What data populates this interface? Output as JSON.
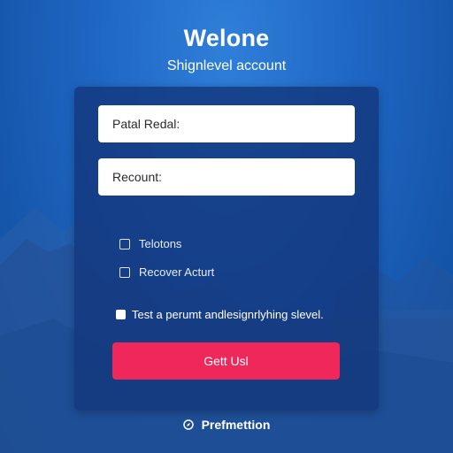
{
  "header": {
    "title": "Welone",
    "subtitle": "Shignlevel account"
  },
  "form": {
    "field_1": {
      "value": "Patal Redal:"
    },
    "field_2": {
      "value": "Recount:"
    },
    "checkboxes": [
      {
        "label": "Telotons",
        "checked": false
      },
      {
        "label": "Recover Acturt",
        "checked": false
      }
    ],
    "terms": {
      "label": "Test a perumt andlesignrlyhing slevel.",
      "checked": false
    },
    "submit_label": "Gett Usl"
  },
  "footer": {
    "label": "Prefmettion",
    "icon": "compass-icon"
  },
  "colors": {
    "background": "#1f67c4",
    "card": "#14377d",
    "accent": "#f0275a",
    "text": "#ffffff"
  }
}
